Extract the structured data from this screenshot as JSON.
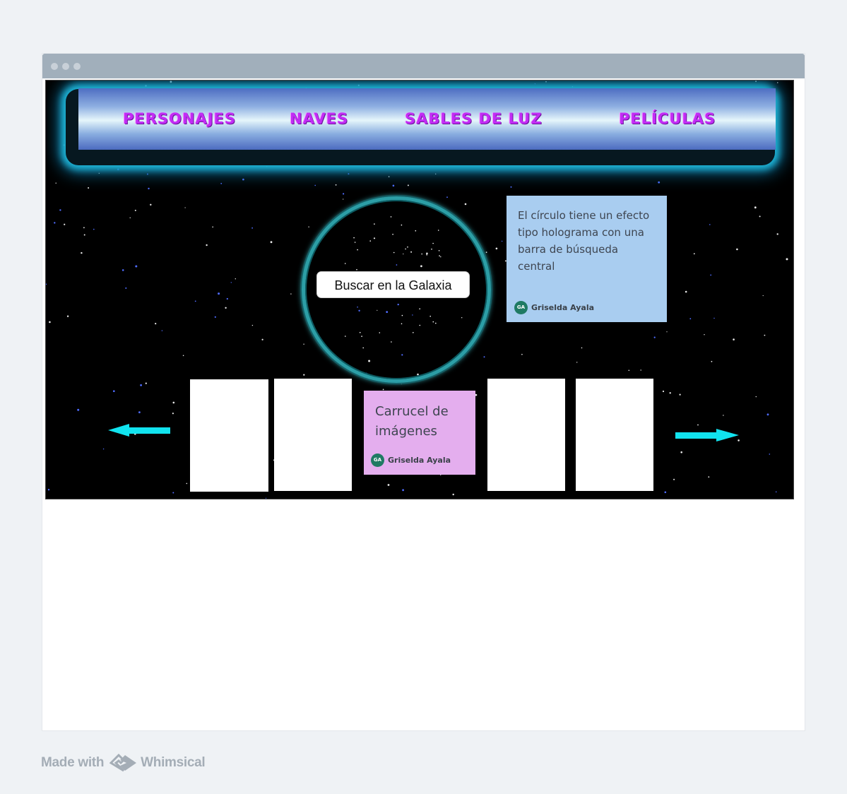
{
  "nav": {
    "items": [
      {
        "label": "PERSONAJES"
      },
      {
        "label": "NAVES"
      },
      {
        "label": "SABLES DE LUZ"
      },
      {
        "label": "PELÍCULAS"
      }
    ]
  },
  "search": {
    "placeholder": "Buscar en la Galaxia"
  },
  "notes": {
    "hologram": {
      "text": "El círculo tiene un efecto tipo holograma con una barra de búsqueda central",
      "initials": "GA",
      "author": "Griselda Ayala",
      "color": "#a9cdf0"
    },
    "carousel": {
      "text": "Carrucel de imágenes",
      "initials": "GA",
      "author": "Griselda Ayala",
      "color": "#e4aeee"
    }
  },
  "carousel": {
    "slides": 5,
    "arrow_color": "#11e3ef"
  },
  "footer": {
    "made_with": "Made with",
    "brand": "Whimsical"
  },
  "colors": {
    "nav_text": "#c22cf5",
    "nav_glow": "#1fb6d8",
    "ring": "#2c9ea6",
    "space": "#000000"
  }
}
